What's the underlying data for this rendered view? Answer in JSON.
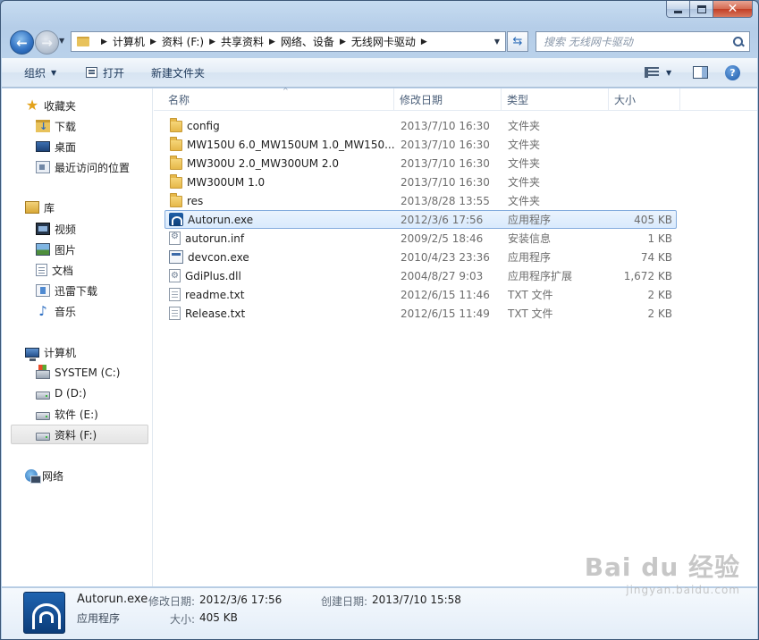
{
  "address": {
    "breadcrumbs": [
      "计算机",
      "资料 (F:)",
      "共享资料",
      "网络、设备",
      "无线网卡驱动"
    ],
    "search_placeholder": "搜索 无线网卡驱动"
  },
  "toolbar": {
    "organize": "组织",
    "open": "打开",
    "new_folder": "新建文件夹"
  },
  "nav": {
    "favorites": "收藏夹",
    "downloads": "下载",
    "desktop": "桌面",
    "recent": "最近访问的位置",
    "libraries": "库",
    "videos": "视频",
    "pictures": "图片",
    "documents": "文档",
    "thunder": "迅雷下载",
    "music": "音乐",
    "computer": "计算机",
    "drive_c": "SYSTEM (C:)",
    "drive_d": "D (D:)",
    "drive_e": "软件 (E:)",
    "drive_f": "资料 (F:)",
    "network": "网络"
  },
  "columns": {
    "name": "名称",
    "date": "修改日期",
    "type": "类型",
    "size": "大小"
  },
  "files": [
    {
      "name": "config",
      "date": "2013/7/10 16:30",
      "type": "文件夹",
      "size": "",
      "icon": "folder-icon"
    },
    {
      "name": "MW150U 6.0_MW150UM 1.0_MW150...",
      "date": "2013/7/10 16:30",
      "type": "文件夹",
      "size": "",
      "icon": "folder-icon"
    },
    {
      "name": "MW300U 2.0_MW300UM 2.0",
      "date": "2013/7/10 16:30",
      "type": "文件夹",
      "size": "",
      "icon": "folder-icon"
    },
    {
      "name": "MW300UM 1.0",
      "date": "2013/7/10 16:30",
      "type": "文件夹",
      "size": "",
      "icon": "folder-icon"
    },
    {
      "name": "res",
      "date": "2013/8/28 13:55",
      "type": "文件夹",
      "size": "",
      "icon": "folder-icon"
    },
    {
      "name": "Autorun.exe",
      "date": "2012/3/6 17:56",
      "type": "应用程序",
      "size": "405 KB",
      "icon": "app-icon"
    },
    {
      "name": "autorun.inf",
      "date": "2009/2/5 18:46",
      "type": "安装信息",
      "size": "1 KB",
      "icon": "inf-icon"
    },
    {
      "name": "devcon.exe",
      "date": "2010/4/23 23:36",
      "type": "应用程序",
      "size": "74 KB",
      "icon": "exe-icon"
    },
    {
      "name": "GdiPlus.dll",
      "date": "2004/8/27 9:03",
      "type": "应用程序扩展",
      "size": "1,672 KB",
      "icon": "dll-icon"
    },
    {
      "name": "readme.txt",
      "date": "2012/6/15 11:46",
      "type": "TXT 文件",
      "size": "2 KB",
      "icon": "txt-icon"
    },
    {
      "name": "Release.txt",
      "date": "2012/6/15 11:49",
      "type": "TXT 文件",
      "size": "2 KB",
      "icon": "txt-icon"
    }
  ],
  "details": {
    "name": "Autorun.exe",
    "type": "应用程序",
    "modified_label": "修改日期:",
    "modified_value": "2012/3/6 17:56",
    "created_label": "创建日期:",
    "created_value": "2013/7/10 15:58",
    "size_label": "大小:",
    "size_value": "405 KB"
  },
  "watermark": {
    "main": "Bai du 经验",
    "sub": "jingyan.baidu.com"
  }
}
